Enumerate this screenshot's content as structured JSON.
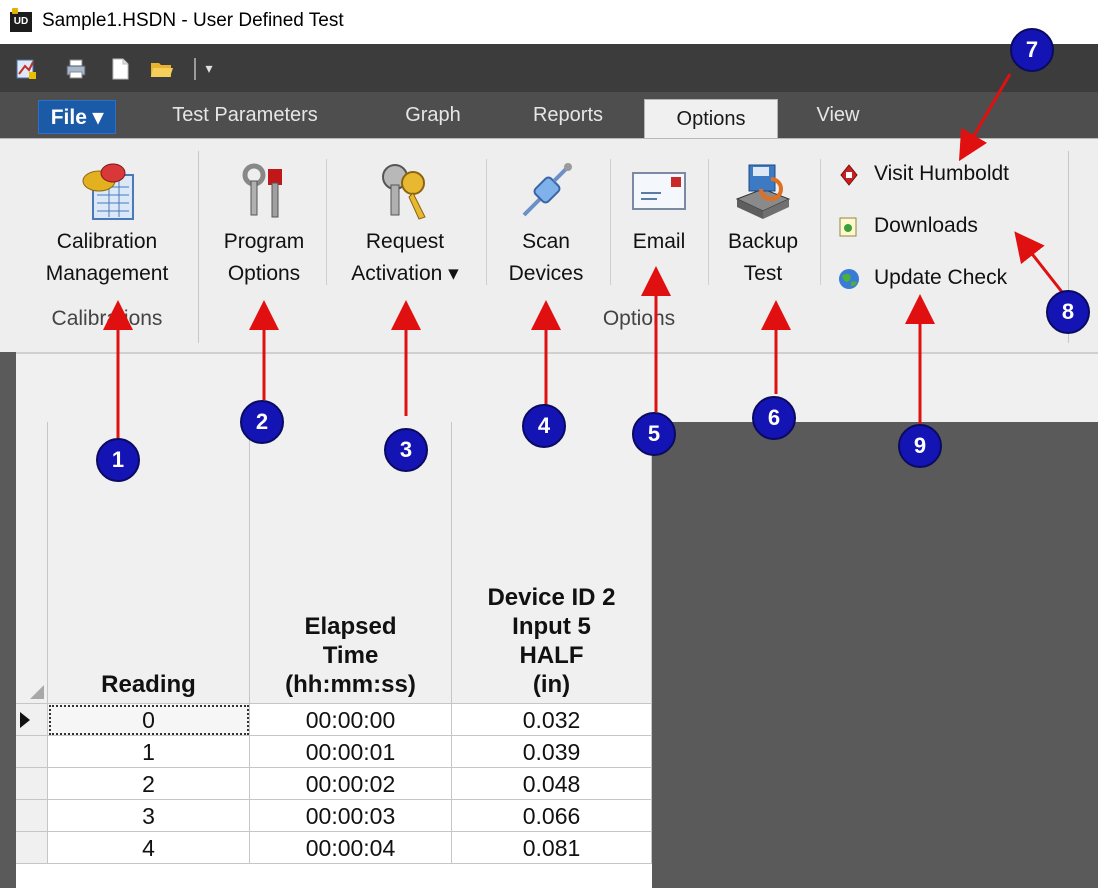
{
  "window": {
    "title": "Sample1.HSDN - User Defined Test",
    "app_icon_text": "UD"
  },
  "quick_access": {
    "items": [
      {
        "name": "new-test-icon"
      },
      {
        "name": "print-icon"
      },
      {
        "name": "new-document-icon"
      },
      {
        "name": "open-folder-icon"
      }
    ],
    "customize_glyph": "▾"
  },
  "tabs": [
    {
      "label": "File ▾",
      "active": false
    },
    {
      "label": "Test Parameters",
      "active": false
    },
    {
      "label": "Graph",
      "active": false
    },
    {
      "label": "Reports",
      "active": false
    },
    {
      "label": "Options",
      "active": true
    },
    {
      "label": "View",
      "active": false
    }
  ],
  "ribbon": {
    "groups": [
      {
        "label": "Calibrations"
      },
      {
        "label": "Options"
      }
    ],
    "buttons": [
      {
        "line1": "Calibration",
        "line2": "Management",
        "icon": "calibration-icon"
      },
      {
        "line1": "Program",
        "line2": "Options",
        "icon": "tools-icon"
      },
      {
        "line1": "Request",
        "line2": "Activation ▾",
        "icon": "keys-icon"
      },
      {
        "line1": "Scan",
        "line2": "Devices",
        "icon": "plug-icon"
      },
      {
        "line1": "Email",
        "line2": "",
        "icon": "envelope-icon"
      },
      {
        "line1": "Backup",
        "line2": "Test",
        "icon": "backup-icon"
      }
    ],
    "small_buttons": [
      {
        "label": "Visit Humboldt",
        "icon": "humboldt-logo-icon"
      },
      {
        "label": "Downloads",
        "icon": "download-page-icon"
      },
      {
        "label": "Update Check",
        "icon": "globe-icon"
      }
    ]
  },
  "grid": {
    "columns": [
      {
        "header": "Reading"
      },
      {
        "header": "Elapsed\nTime\n(hh:mm:ss)"
      },
      {
        "header": "Device ID 2\nInput 5\nHALF\n(in)"
      }
    ],
    "rows": [
      [
        "0",
        "00:00:00",
        "0.032"
      ],
      [
        "1",
        "00:00:01",
        "0.039"
      ],
      [
        "2",
        "00:00:02",
        "0.048"
      ],
      [
        "3",
        "00:00:03",
        "0.066"
      ],
      [
        "4",
        "00:00:04",
        "0.081"
      ]
    ]
  },
  "callouts": [
    "1",
    "2",
    "3",
    "4",
    "5",
    "6",
    "7",
    "8",
    "9"
  ],
  "colors": {
    "callout_fill": "#1414b4",
    "arrow": "#e01010",
    "file_tab": "#1a5aa6",
    "dark_toolbar": "#3c3c3c"
  }
}
